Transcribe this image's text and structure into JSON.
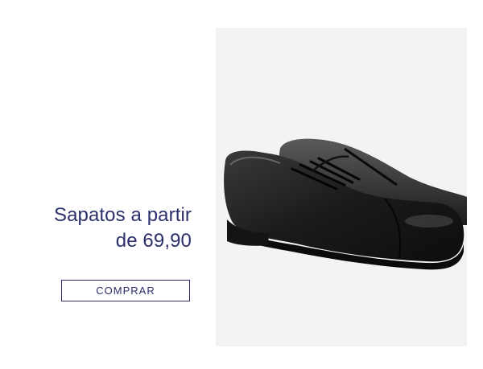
{
  "banner": {
    "headline_line1": "Sapatos a partir",
    "headline_line2": "de 69,90",
    "cta_label": "COMPRAR",
    "accent_color": "#2b2f6b",
    "product_image": {
      "icon": "shoes-photo",
      "background_color": "#f3f3f3"
    }
  }
}
